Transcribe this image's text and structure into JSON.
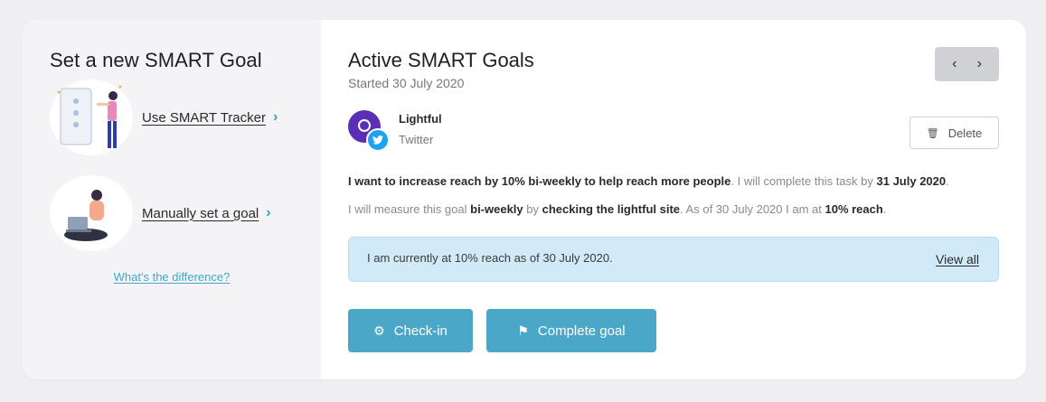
{
  "left_panel": {
    "title": "Set a new SMART Goal",
    "options": [
      {
        "label": "Use SMART Tracker",
        "chevron": "›",
        "icon": "tracker-illustration"
      },
      {
        "label": "Manually set a goal",
        "chevron": "›",
        "icon": "laptop-illustration"
      }
    ],
    "difference_link": "What's the difference?"
  },
  "goals": {
    "title": "Active SMART Goals",
    "started": "Started 30 July 2020",
    "pager": {
      "prev": "‹",
      "next": "›"
    },
    "account": {
      "name": "Lightful",
      "platform": "Twitter",
      "badge_icon": "twitter-icon"
    },
    "delete_label": "Delete",
    "statement": {
      "goal": "I want to increase reach by 10% bi-weekly to help reach more people",
      "complete_prefix": ". I will complete this task by ",
      "deadline": "31 July 2020",
      "end": "."
    },
    "measure": {
      "prefix": "I will measure this goal ",
      "frequency": "bi-weekly",
      "by": " by ",
      "method": "checking the lightful site",
      "progress_prefix": ". As of 30 July 2020 I am at ",
      "progress": "10% reach",
      "end": "."
    },
    "info_message": "I am currently at 10% reach as of 30 July 2020.",
    "view_all": "View all",
    "buttons": {
      "checkin": "Check-in",
      "complete": "Complete goal"
    }
  },
  "colors": {
    "accent": "#4ba7c7",
    "link": "#3fa9cc",
    "info_bg": "#d1eaf8",
    "avatar": "#5a2fb5",
    "twitter": "#1da1f2"
  }
}
